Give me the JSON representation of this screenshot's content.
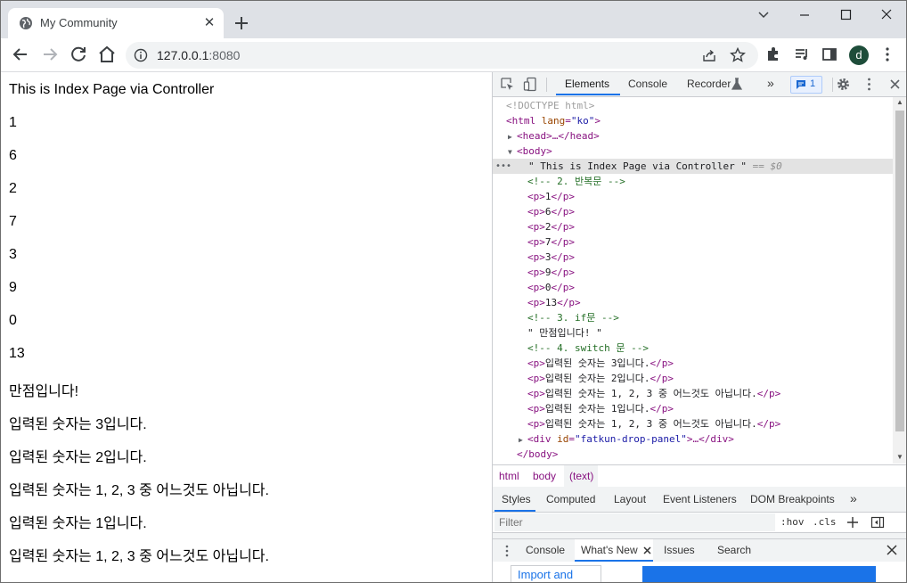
{
  "browser": {
    "tab_title": "My Community",
    "tab_close": "✕",
    "url_host": "127.0.0.1",
    "url_port": ":8080",
    "avatar_letter": "d"
  },
  "page": {
    "lines": [
      "This is Index Page via Controller",
      "1",
      "6",
      "2",
      "7",
      "3",
      "9",
      "0",
      "13",
      "만점입니다!",
      "입력된 숫자는 3입니다.",
      "입력된 숫자는 2입니다.",
      "입력된 숫자는 1, 2, 3 중 어느것도 아닙니다.",
      "입력된 숫자는 1입니다.",
      "입력된 숫자는 1, 2, 3 중 어느것도 아닙니다."
    ]
  },
  "devtools": {
    "tabs": {
      "elements": "Elements",
      "console": "Console",
      "recorder": "Recorder",
      "more": "»"
    },
    "issues_count": "1",
    "dom": {
      "doctype": "<!DOCTYPE html>",
      "html_open": "<html",
      "html_lang_attr": "lang",
      "html_lang_val": "\"ko\"",
      "html_close_bracket": ">",
      "head": "<head>…</head>",
      "body_open": "<body>",
      "selected_text": "\" This is Index Page via Controller \"",
      "selected_suffix": "== $0",
      "comment_loop": "<!-- 2. 반복문 -->",
      "p_items": [
        "1",
        "6",
        "2",
        "7",
        "3",
        "9",
        "0",
        "13"
      ],
      "comment_if": "<!-- 3. if문 -->",
      "text_perfect": "\" 만점입니다! \"",
      "comment_switch": "<!-- 4. switch 문 -->",
      "switch_items": [
        "입력된 숫자는 3입니다.",
        "입력된 숫자는 2입니다.",
        "입력된 숫자는 1, 2, 3 중 어느것도 아닙니다.",
        "입력된 숫자는 1입니다.",
        "입력된 숫자는 1, 2, 3 중 어느것도 아닙니다."
      ],
      "div_open": "<div",
      "div_id_attr": "id",
      "div_id_val": "\"fatkun-drop-panel\"",
      "div_rest": ">…</div>",
      "body_close": "</body>"
    },
    "breadcrumbs": [
      "html",
      "body",
      "(text)"
    ],
    "subtabs": [
      "Styles",
      "Computed",
      "Layout",
      "Event Listeners",
      "DOM Breakpoints",
      "»"
    ],
    "filter_placeholder": "Filter",
    "filter_hov": ":hov",
    "filter_cls": ".cls",
    "drawer_tabs": [
      "Console",
      "What's New",
      "Issues",
      "Search"
    ],
    "drawer_import_link": "Import and"
  }
}
